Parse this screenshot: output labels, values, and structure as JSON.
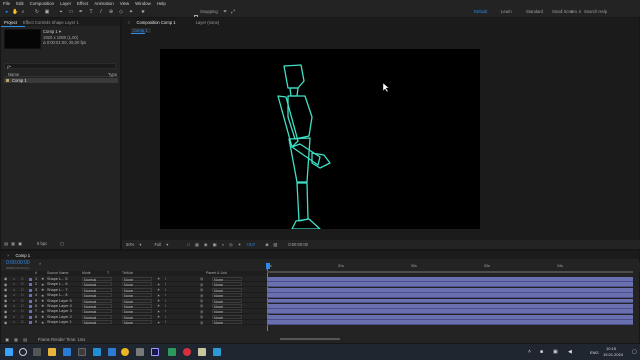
{
  "menu": [
    "File",
    "Edit",
    "Composition",
    "Layer",
    "Effect",
    "Animation",
    "View",
    "Window",
    "Help"
  ],
  "toolbar": {
    "snapping_label": "Snapping",
    "workspaces": [
      "Default",
      "Learn",
      "Standard",
      "Small Screen"
    ],
    "search_placeholder": "Search Help"
  },
  "project": {
    "tabs": [
      "Project",
      "Effect Controls Shape Layer 1"
    ],
    "comp_name": "Comp 1 ▾",
    "comp_info_1": "1920 x 1080 (1,00)",
    "comp_info_2": "Δ 0:00:01:00, 25,00 fps",
    "search_placeholder": "ρ•",
    "col_name": "Name",
    "col_type": "Type",
    "item_name": "Comp 1",
    "bpc": "8 bpc"
  },
  "viewer": {
    "tabs": [
      "Composition Comp 1",
      "Layer (none)"
    ],
    "sub_tab": "Comp 1",
    "zoom": "50%",
    "resolution": "Full",
    "exposure": "+0,0",
    "timecode": "0:00:00:00"
  },
  "timeline": {
    "tab": "Comp 1",
    "timecode": "0:00:00:00",
    "fps": "00000 (25.00 fps)",
    "headers": {
      "num": "#",
      "source": "Source Name",
      "mode": "Mode",
      "trkmat": "TrkMat",
      "parent": "Parent & Link",
      "track": "T"
    },
    "ruler": [
      "0s",
      "01s",
      "02s",
      "03s",
      "04s"
    ],
    "layers": [
      {
        "num": "1",
        "name": "Shape L... 5",
        "mode": "Normal",
        "trk": "None",
        "parent": "None"
      },
      {
        "num": "2",
        "name": "Shape L... 6",
        "mode": "Normal",
        "trk": "None",
        "parent": "None"
      },
      {
        "num": "3",
        "name": "Shape L... 7",
        "mode": "Normal",
        "trk": "None",
        "parent": "None"
      },
      {
        "num": "4",
        "name": "Shape L... 8",
        "mode": "Normal",
        "trk": "None",
        "parent": "None"
      },
      {
        "num": "5",
        "name": "Shape Layer 5",
        "mode": "Normal",
        "trk": "None",
        "parent": "None"
      },
      {
        "num": "6",
        "name": "Shape Layer 4",
        "mode": "Normal",
        "trk": "None",
        "parent": "None"
      },
      {
        "num": "7",
        "name": "Shape Layer 3",
        "mode": "Normal",
        "trk": "None",
        "parent": "None"
      },
      {
        "num": "8",
        "name": "Shape Layer 2",
        "mode": "Normal",
        "trk": "None",
        "parent": "None"
      },
      {
        "num": "9",
        "name": "Shape Layer 1",
        "mode": "Normal",
        "trk": "None",
        "parent": "None"
      }
    ],
    "render_time": "Frame Render Time: 1ms"
  },
  "taskbar": {
    "time": "10:15",
    "date": "19.01.2024",
    "lang": "ENG"
  },
  "colors": {
    "accent": "#2d8ceb",
    "figure_stroke": "#3fe0c5",
    "track": "#6a6fb0"
  }
}
